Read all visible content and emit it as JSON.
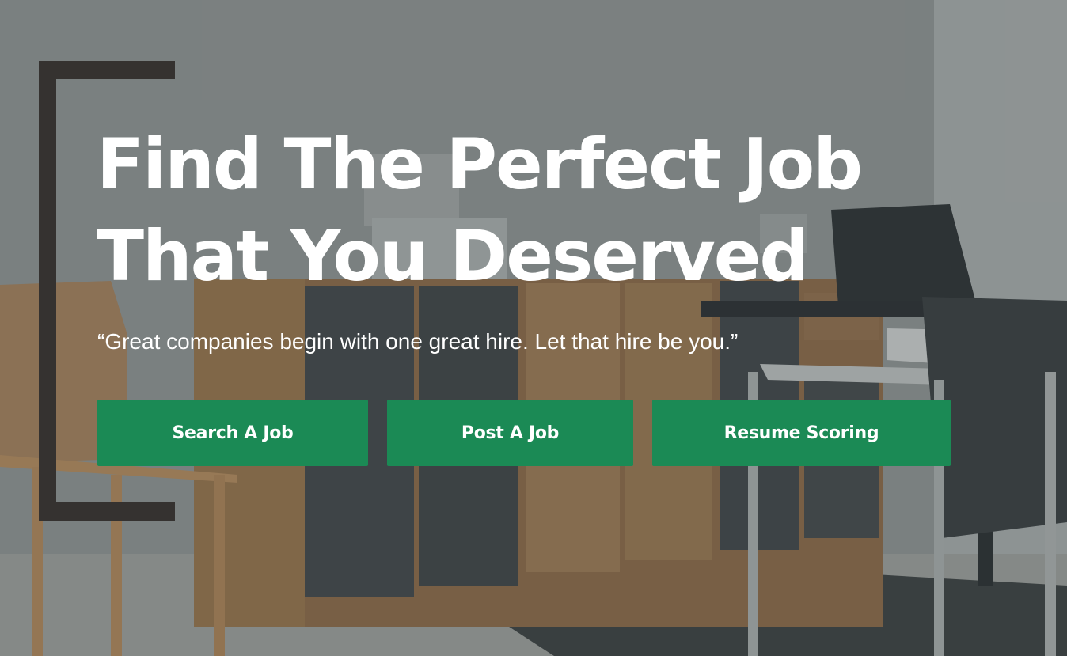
{
  "hero": {
    "headline_line1": "Find The Perfect Job",
    "headline_line2": "That You Deserved",
    "tagline": "“Great companies begin with one great hire. Let that hire be you.”"
  },
  "actions": {
    "search_label": "Search A Job",
    "post_label": "Post A Job",
    "resume_label": "Resume Scoring"
  },
  "colors": {
    "button_green": "#1b8a55",
    "bracket_dark": "#353230",
    "text_white": "#ffffff"
  }
}
